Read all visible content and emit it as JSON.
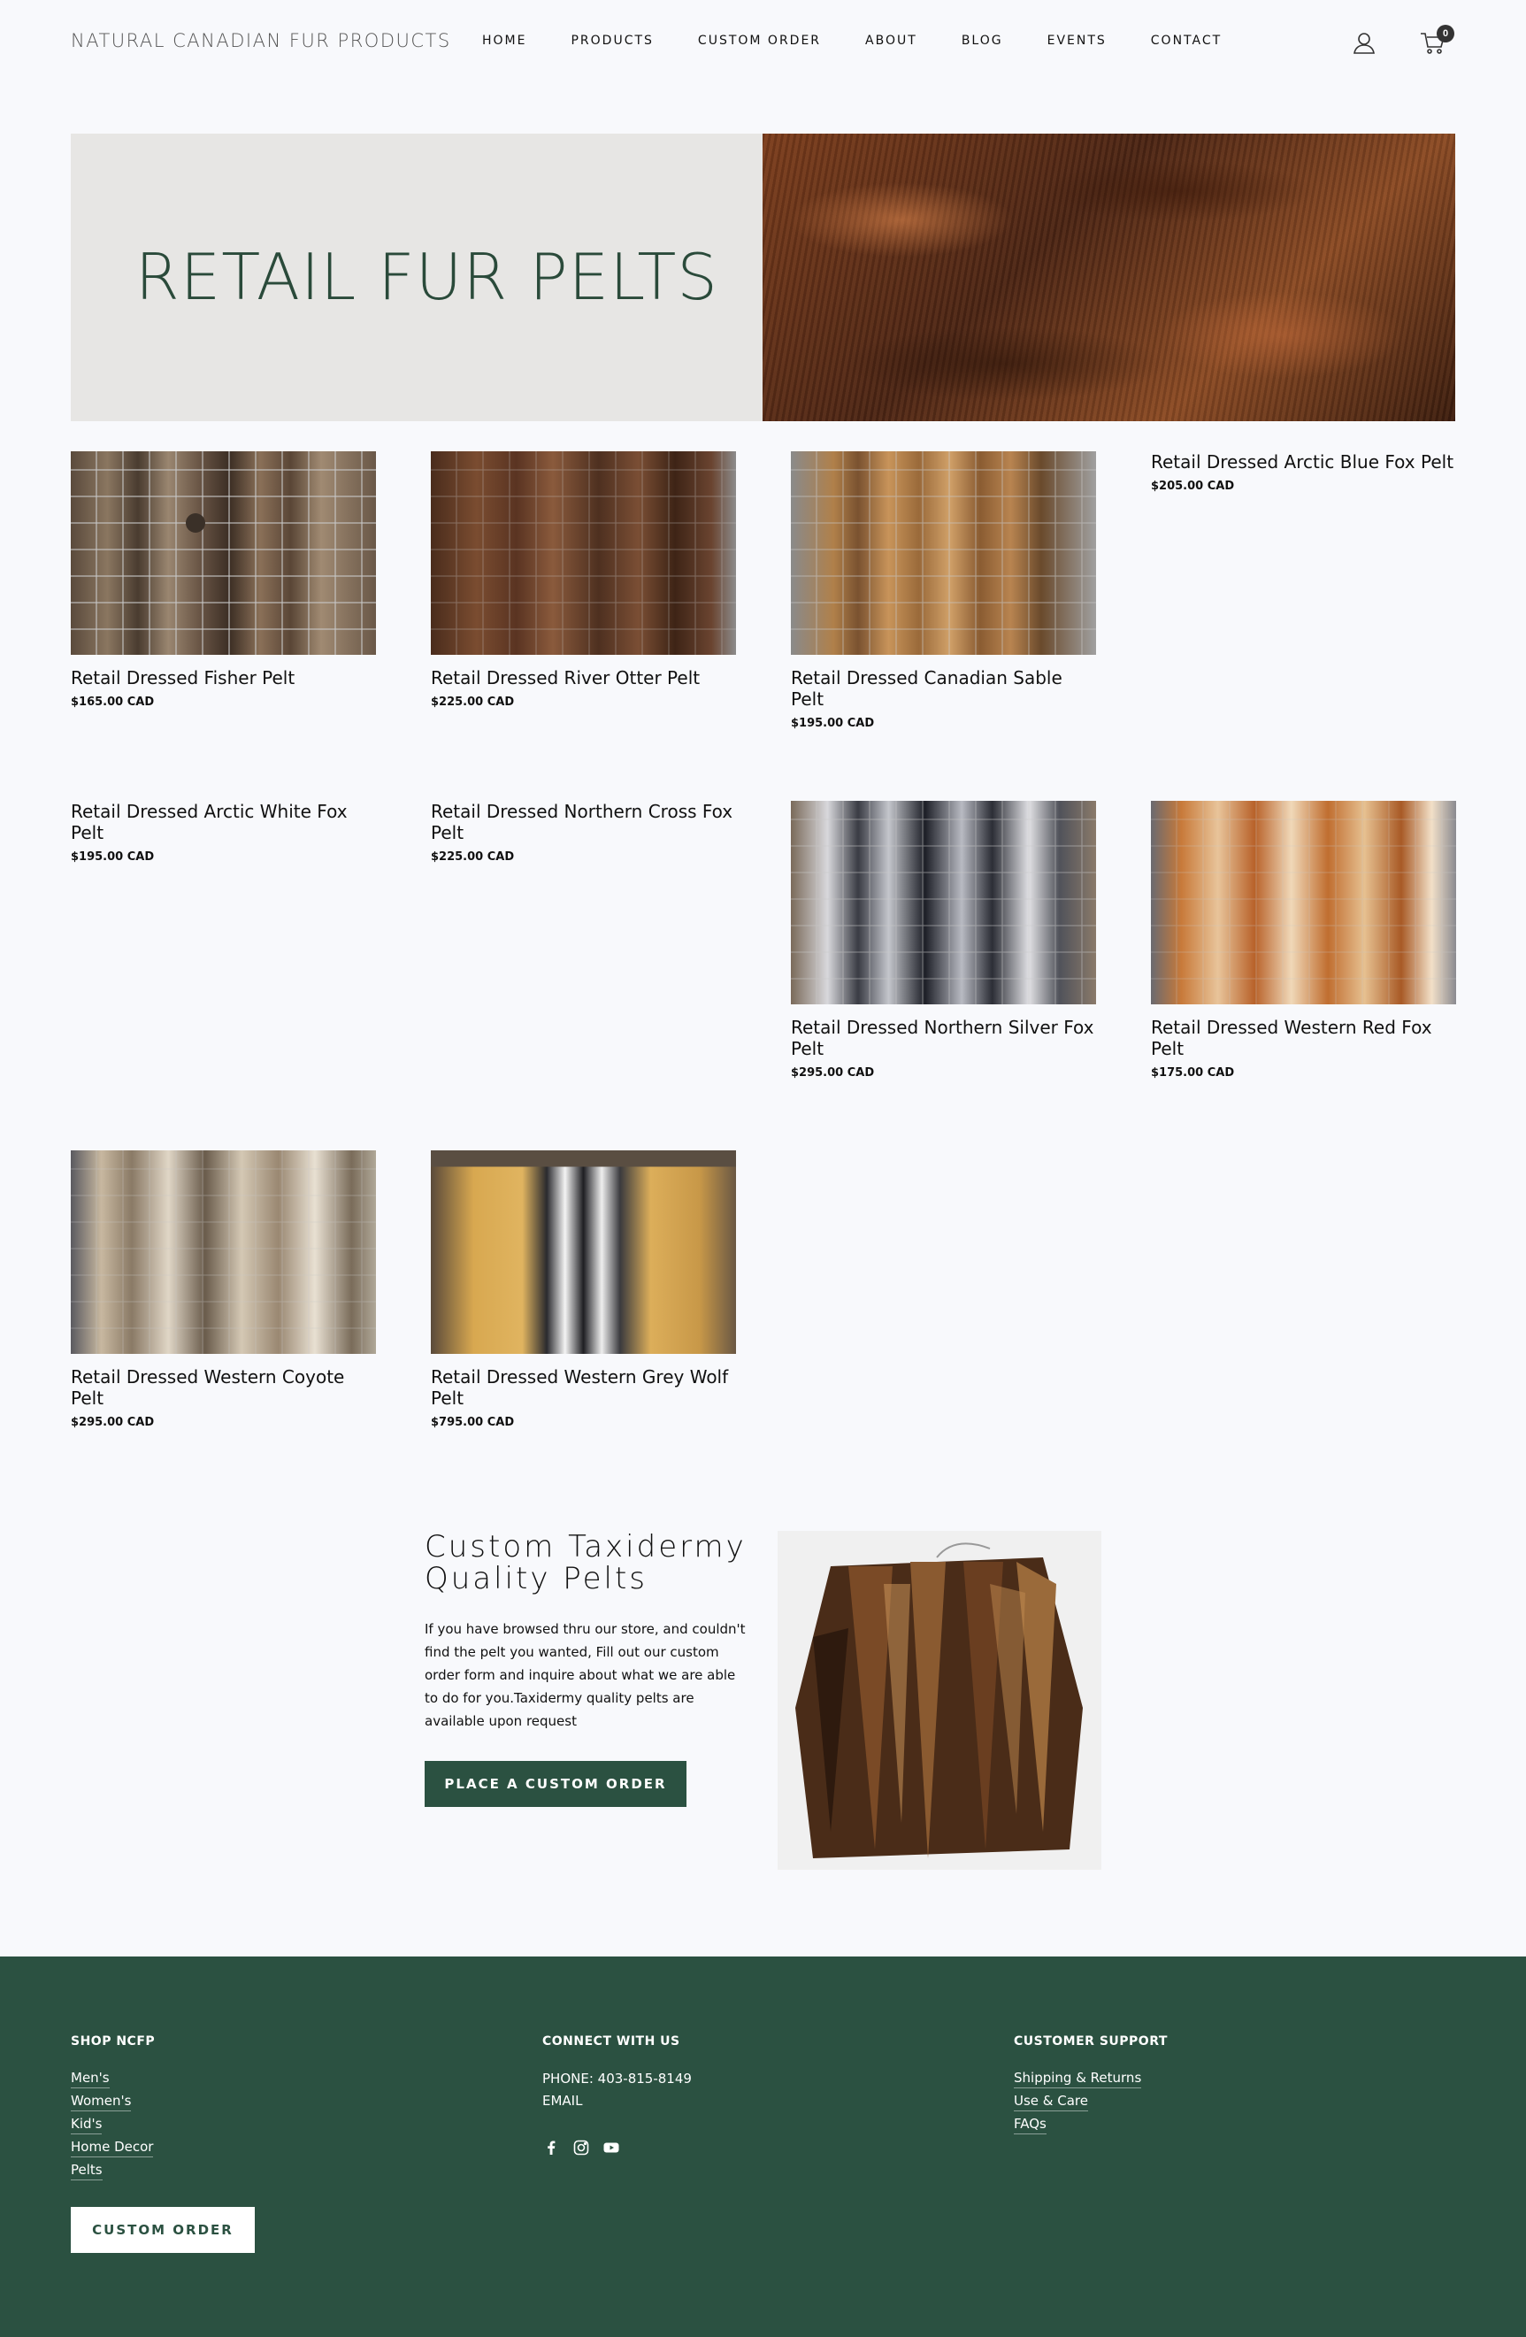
{
  "header": {
    "brand": "NATURAL CANADIAN FUR PRODUCTS",
    "nav": [
      "HOME",
      "PRODUCTS",
      "CUSTOM ORDER",
      "ABOUT",
      "BLOG",
      "EVENTS",
      "CONTACT"
    ],
    "cart_count": "0",
    "icons": [
      "account-icon",
      "cart-icon"
    ]
  },
  "hero": {
    "title": "RETAIL FUR PELTS"
  },
  "products": [
    {
      "name": "Retail Dressed Fisher Pelt",
      "price": "$165.00 CAD"
    },
    {
      "name": "Retail Dressed River Otter Pelt",
      "price": "$225.00 CAD"
    },
    {
      "name": "Retail Dressed Canadian Sable Pelt",
      "price": "$195.00 CAD"
    },
    {
      "name": "Retail Dressed Arctic Blue Fox Pelt",
      "price": "$205.00 CAD"
    },
    {
      "name": "Retail Dressed Arctic White Fox Pelt",
      "price": "$195.00 CAD"
    },
    {
      "name": "Retail Dressed Northern Cross Fox Pelt",
      "price": "$225.00 CAD"
    },
    {
      "name": "Retail Dressed Northern Silver Fox Pelt",
      "price": "$295.00 CAD"
    },
    {
      "name": "Retail Dressed Western Red Fox Pelt",
      "price": "$175.00 CAD"
    },
    {
      "name": "Retail Dressed Western Coyote Pelt",
      "price": "$295.00 CAD"
    },
    {
      "name": "Retail Dressed Western Grey Wolf Pelt",
      "price": "$795.00 CAD"
    }
  ],
  "custom": {
    "title": "Custom Taxidermy Quality Pelts",
    "text": "If you have browsed thru our store, and couldn't find the pelt you wanted, Fill out our custom order form and inquire about what we are able to do for you.Taxidermy quality pelts are available upon request",
    "button": "PLACE A CUSTOM ORDER"
  },
  "footer": {
    "shop": {
      "heading": "SHOP NCFP",
      "links": [
        "Men's",
        "Women's",
        "Kid's",
        "Home Decor",
        "Pelts"
      ]
    },
    "connect": {
      "heading": "CONNECT WITH US",
      "phone": "PHONE: 403-815-8149",
      "email": "EMAIL",
      "social": [
        "facebook-icon",
        "instagram-icon",
        "youtube-icon"
      ]
    },
    "support": {
      "heading": "CUSTOMER SUPPORT",
      "links": [
        "Shipping & Returns",
        "Use & Care",
        "FAQs"
      ]
    },
    "button": "CUSTOM ORDER"
  },
  "colors": {
    "brand_green": "#2b5141",
    "hero_text": "#2a4a3a",
    "hero_bg": "#e7e6e4",
    "page_bg": "#f8f9fc"
  }
}
